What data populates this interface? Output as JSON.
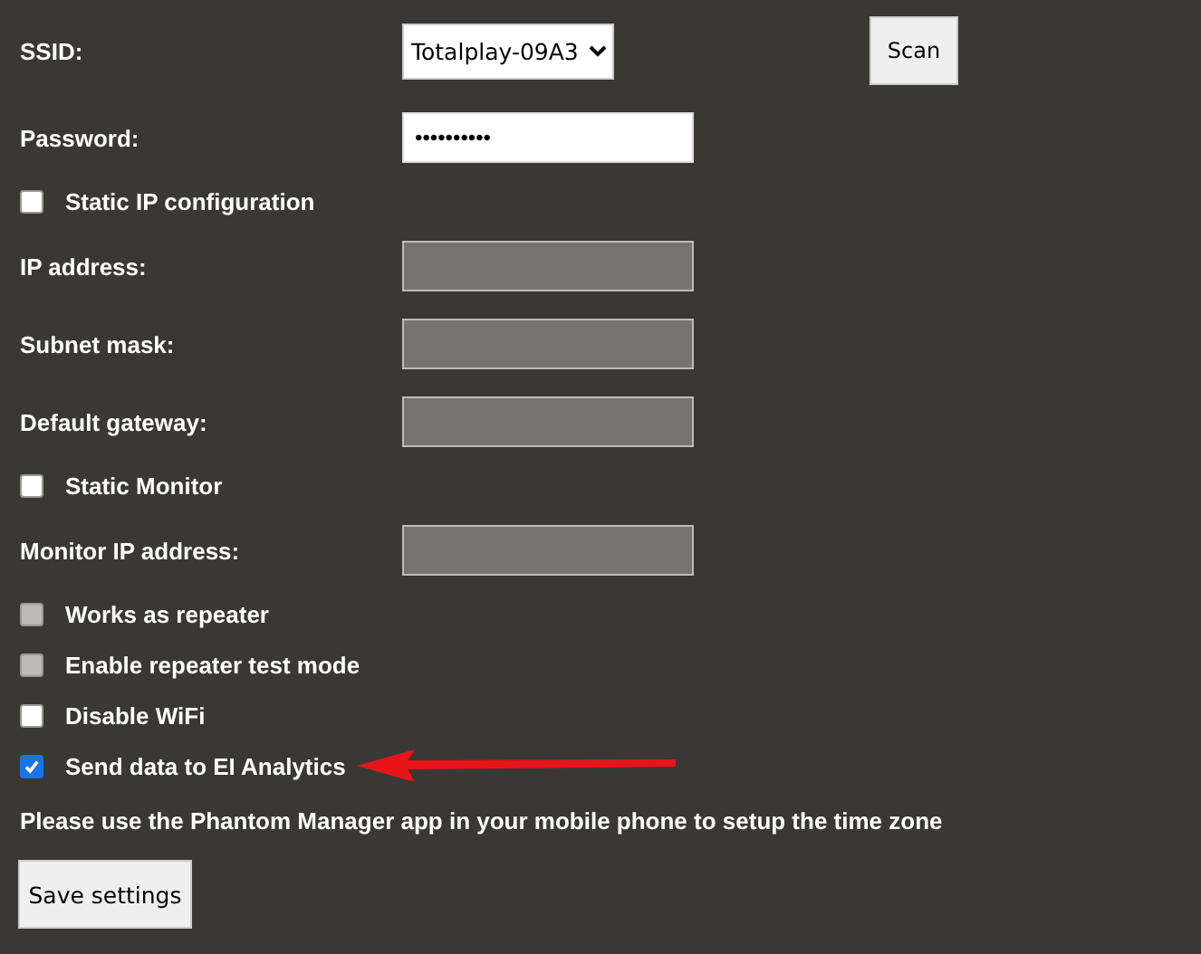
{
  "rows": [
    {
      "kind": "select",
      "label": "SSID:",
      "value": "Totalplay-09A3",
      "button": "Scan"
    },
    {
      "kind": "password",
      "label": "Password:",
      "value": "••••••••••",
      "disabled": false
    },
    {
      "kind": "checkbox",
      "label": "Static IP configuration",
      "checked": false,
      "disabled": false,
      "arrow": false
    },
    {
      "kind": "text",
      "label": "IP address:",
      "value": "",
      "disabled": true
    },
    {
      "kind": "text",
      "label": "Subnet mask:",
      "value": "",
      "disabled": true
    },
    {
      "kind": "text",
      "label": "Default gateway:",
      "value": "",
      "disabled": true
    },
    {
      "kind": "checkbox",
      "label": "Static Monitor",
      "checked": false,
      "disabled": false,
      "arrow": false
    },
    {
      "kind": "text",
      "label": "Monitor IP address:",
      "value": "",
      "disabled": true
    },
    {
      "kind": "checkbox",
      "label": "Works as repeater",
      "checked": false,
      "disabled": true,
      "arrow": false
    },
    {
      "kind": "checkbox",
      "label": "Enable repeater test mode",
      "checked": false,
      "disabled": true,
      "arrow": false
    },
    {
      "kind": "checkbox",
      "label": "Disable WiFi",
      "checked": false,
      "disabled": false,
      "arrow": false
    },
    {
      "kind": "checkbox",
      "label": "Send data to EI Analytics",
      "checked": true,
      "disabled": false,
      "arrow": true
    }
  ],
  "note": "Please use the Phantom Manager app in your mobile phone to setup the time zone",
  "save_button": "Save settings"
}
